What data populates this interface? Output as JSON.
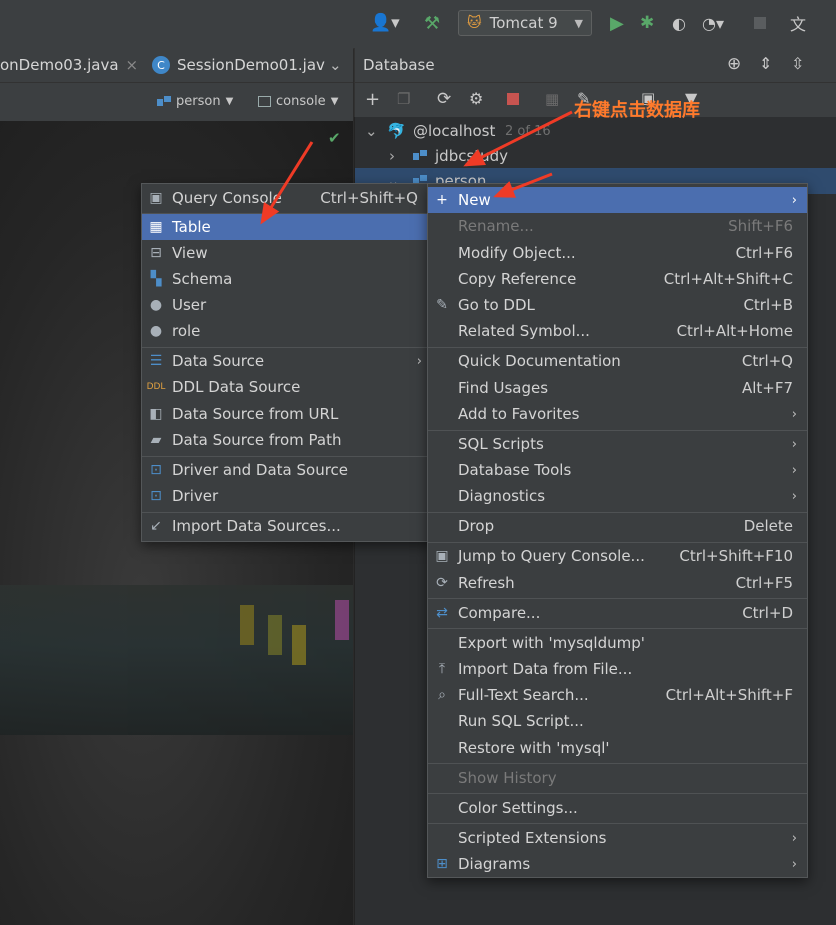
{
  "toolbar": {
    "run_config": "Tomcat 9"
  },
  "editor": {
    "tabs": [
      {
        "label": "onDemo03.java",
        "close": "×"
      },
      {
        "label": "SessionDemo01.jav",
        "badge": "C"
      }
    ],
    "schema_selector": "person",
    "console_selector": "console"
  },
  "database_panel": {
    "title": "Database",
    "tree": {
      "host": "@localhost",
      "host_count": "2 of 16",
      "items": [
        "jdbcstudy",
        "person"
      ]
    },
    "annotation": "右键点击数据库"
  },
  "new_submenu": {
    "items": [
      {
        "label": "Query Console",
        "shortcut": "Ctrl+Shift+Q",
        "icon": "query-console-icon"
      },
      {
        "label": "Table",
        "highlighted": true,
        "icon": "table-icon"
      },
      {
        "label": "View",
        "icon": "view-icon"
      },
      {
        "label": "Schema",
        "icon": "schema-icon"
      },
      {
        "label": "User",
        "icon": "user-icon"
      },
      {
        "label": "role",
        "icon": "user-icon"
      },
      {
        "label": "Data Source",
        "submenu": true,
        "icon": "datasource-icon"
      },
      {
        "label": "DDL Data Source",
        "icon": "ddl-icon"
      },
      {
        "label": "Data Source from URL",
        "icon": "url-icon"
      },
      {
        "label": "Data Source from Path",
        "icon": "folder-icon"
      },
      {
        "label": "Driver and Data Source",
        "icon": "driver-icon"
      },
      {
        "label": "Driver",
        "icon": "driver-icon"
      },
      {
        "label": "Import Data Sources...",
        "icon": "import-icon"
      }
    ]
  },
  "context_menu": {
    "items": [
      {
        "label": "New",
        "submenu": true,
        "highlighted": true,
        "icon": "plus-icon"
      },
      {
        "label": "Rename...",
        "shortcut": "Shift+F6",
        "disabled": true
      },
      {
        "label": "Modify Object...",
        "shortcut": "Ctrl+F6"
      },
      {
        "label": "Copy Reference",
        "shortcut": "Ctrl+Alt+Shift+C"
      },
      {
        "label": "Go to DDL",
        "shortcut": "Ctrl+B",
        "icon": "pencil-icon"
      },
      {
        "label": "Related Symbol...",
        "shortcut": "Ctrl+Alt+Home"
      },
      {
        "label": "Quick Documentation",
        "shortcut": "Ctrl+Q"
      },
      {
        "label": "Find Usages",
        "shortcut": "Alt+F7"
      },
      {
        "label": "Add to Favorites",
        "submenu": true
      },
      {
        "label": "SQL Scripts",
        "submenu": true
      },
      {
        "label": "Database Tools",
        "submenu": true
      },
      {
        "label": "Diagnostics",
        "submenu": true
      },
      {
        "label": "Drop",
        "shortcut": "Delete"
      },
      {
        "label": "Jump to Query Console...",
        "shortcut": "Ctrl+Shift+F10",
        "icon": "query-console-icon"
      },
      {
        "label": "Refresh",
        "shortcut": "Ctrl+F5",
        "icon": "refresh-icon"
      },
      {
        "label": "Compare...",
        "shortcut": "Ctrl+D",
        "icon": "compare-icon"
      },
      {
        "label": "Export with 'mysqldump'"
      },
      {
        "label": "Import Data from File...",
        "icon": "import-up-icon"
      },
      {
        "label": "Full-Text Search...",
        "shortcut": "Ctrl+Alt+Shift+F",
        "icon": "search-icon"
      },
      {
        "label": "Run SQL Script..."
      },
      {
        "label": "Restore with 'mysql'"
      },
      {
        "label": "Show History",
        "disabled": true
      },
      {
        "label": "Color Settings..."
      },
      {
        "label": "Scripted Extensions",
        "submenu": true
      },
      {
        "label": "Diagrams",
        "submenu": true,
        "icon": "diagram-icon"
      }
    ]
  },
  "colors": {
    "highlight": "#4b6eaf",
    "annotation": "#ff7a2c",
    "arrow": "#ef3b26"
  }
}
